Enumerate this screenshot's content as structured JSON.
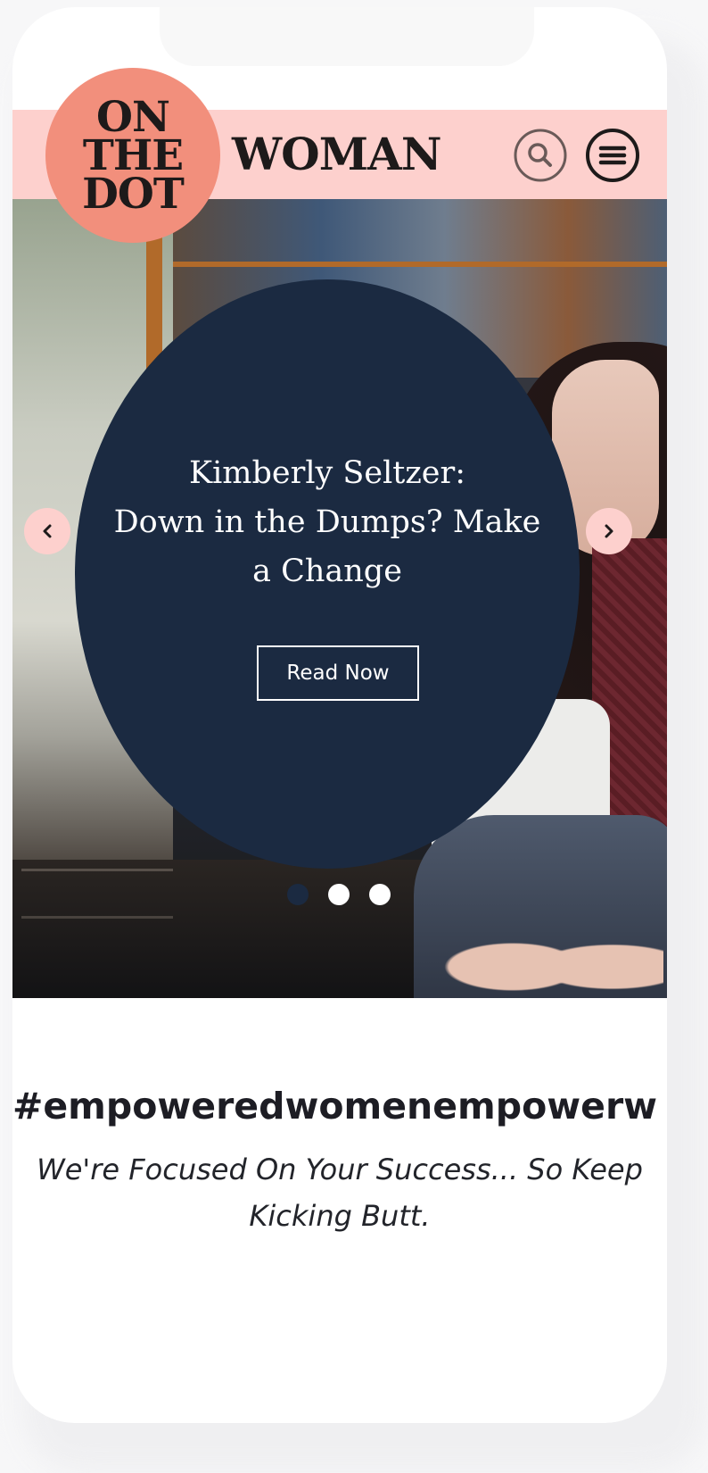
{
  "logo": {
    "lines": [
      "ON",
      "THE",
      "DOT"
    ],
    "word": "WOMAN"
  },
  "header": {
    "search_icon": "search-icon",
    "menu_icon": "hamburger-menu-icon"
  },
  "hero": {
    "slide_title_line1": "Kimberly Seltzer:",
    "slide_title_line2": "Down in the Dumps? Make",
    "slide_title_line3": "a Change",
    "cta_label": "Read Now",
    "prev_icon": "chevron-left-icon",
    "next_icon": "chevron-right-icon",
    "active_slide": 1,
    "slide_count": 3
  },
  "intro": {
    "hashtag": "#empoweredwomenempowerw",
    "tagline_line1": "We're Focused On Your Success... So Keep",
    "tagline_line2": "Kicking Butt."
  },
  "colors": {
    "header_pink": "#fdd0cd",
    "logo_salmon": "#f28f7c",
    "navy": "#1b2a41"
  }
}
